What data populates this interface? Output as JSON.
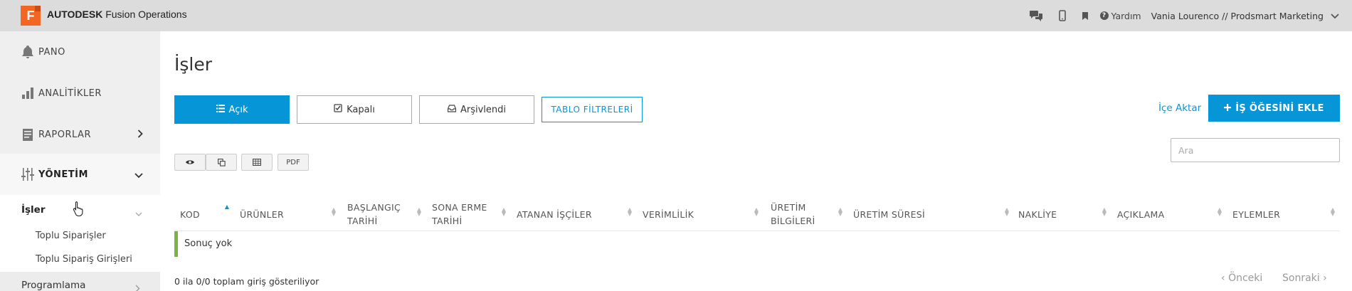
{
  "topbar": {
    "logo_letter": "F",
    "brand_bold": "AUTODESK",
    "brand_rest": "Fusion Operations",
    "help_label": "Yardım",
    "user_label": "Vania Lourenco // Prodsmart Marketing",
    "icons": [
      "chat-icon",
      "mobile-icon",
      "bookmark-icon",
      "help-icon",
      "chevron-down-icon"
    ]
  },
  "sidebar": {
    "items": [
      {
        "label": "PANO",
        "icon": "bell-icon"
      },
      {
        "label": "ANALİTİKLER",
        "icon": "bar-chart-icon"
      },
      {
        "label": "RAPORLAR",
        "icon": "document-icon"
      },
      {
        "label": "YÖNETİM",
        "icon": "sliders-icon"
      }
    ],
    "sub_head": "İşler",
    "sub_links": [
      "Toplu Siparişler",
      "Toplu Sipariş Girişleri"
    ],
    "next_section": "Programlama"
  },
  "main": {
    "title": "İşler",
    "tabs": {
      "open": "Açık",
      "closed": "Kapalı",
      "archived": "Arşivlendi"
    },
    "filters_label": "TABLO FİLTRELERİ",
    "import_label": "İçe Aktar",
    "add_label": "İŞ ÖĞESİNİ EKLE",
    "search_placeholder": "Ara",
    "tools": {
      "pdf": "PDF"
    },
    "columns": [
      {
        "l1": "KOD",
        "l2": ""
      },
      {
        "l1": "ÜRÜNLER",
        "l2": ""
      },
      {
        "l1": "BAŞLANGIÇ",
        "l2": "TARİHİ"
      },
      {
        "l1": "SONA ERME",
        "l2": "TARİHİ"
      },
      {
        "l1": "ATANAN İŞÇİLER",
        "l2": ""
      },
      {
        "l1": "VERİMLİLİK",
        "l2": ""
      },
      {
        "l1": "ÜRETİM",
        "l2": "BİLGİLERİ"
      },
      {
        "l1": "ÜRETİM SÜRESİ",
        "l2": ""
      },
      {
        "l1": "NAKLİYE",
        "l2": ""
      },
      {
        "l1": "AÇIKLAMA",
        "l2": ""
      },
      {
        "l1": "EYLEMLER",
        "l2": ""
      }
    ],
    "empty_text": "Sonuç yok",
    "info_text": "0 ila 0/0 toplam giriş gösteriliyor",
    "prev_label": "Önceki",
    "next_label": "Sonraki"
  },
  "colors": {
    "accent": "#0696d7",
    "logo": "#f26522",
    "row_marker": "#7cb342"
  }
}
